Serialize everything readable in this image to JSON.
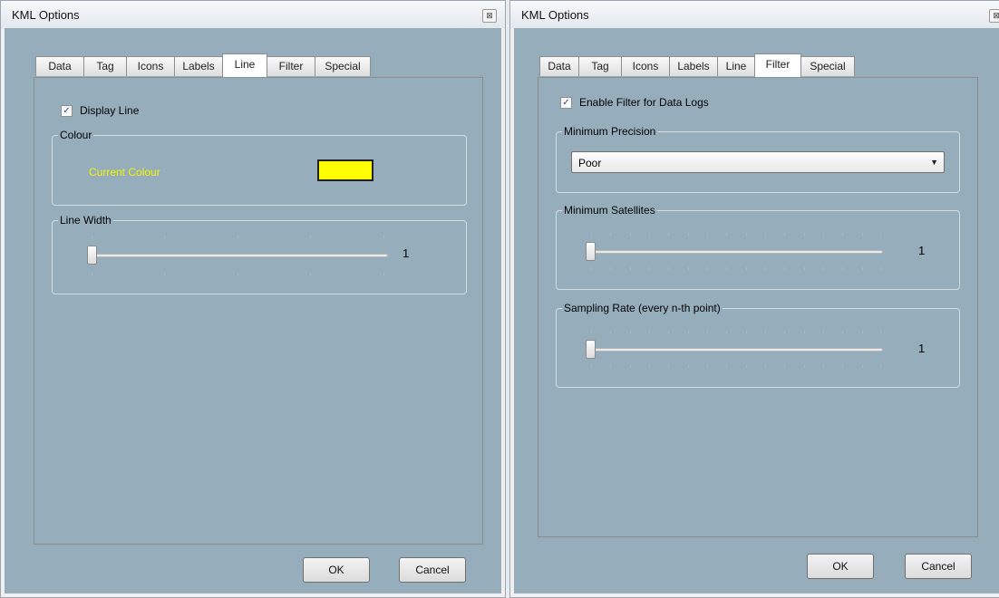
{
  "left_window": {
    "title": "KML Options",
    "close_glyph": "⊠",
    "tabs": [
      {
        "label": "Data"
      },
      {
        "label": "Tag"
      },
      {
        "label": "Icons"
      },
      {
        "label": "Labels"
      },
      {
        "label": "Line",
        "active": true
      },
      {
        "label": "Filter"
      },
      {
        "label": "Special"
      }
    ],
    "display_line": {
      "label": "Display Line",
      "checked": true
    },
    "colour_group": {
      "title": "Colour",
      "label": "Current Colour",
      "label_color": "#f5f500",
      "swatch_color": "#ffff00"
    },
    "line_width_group": {
      "title": "Line Width",
      "value": "1",
      "slider_level": 0
    },
    "ok_label": "OK",
    "cancel_label": "Cancel"
  },
  "right_window": {
    "title": "KML Options",
    "close_glyph": "⊠",
    "tabs": [
      {
        "label": "Data"
      },
      {
        "label": "Tag"
      },
      {
        "label": "Icons"
      },
      {
        "label": "Labels"
      },
      {
        "label": "Line"
      },
      {
        "label": "Filter",
        "active": true
      },
      {
        "label": "Special"
      }
    ],
    "enable_filter": {
      "label": "Enable Filter for Data Logs",
      "checked": true
    },
    "min_precision": {
      "title": "Minimum Precision",
      "selected": "Poor"
    },
    "min_satellites": {
      "title": "Minimum Satellites",
      "value": "1",
      "slider_level": 0
    },
    "sampling_rate": {
      "title": "Sampling Rate (every n-th point)",
      "value": "1",
      "slider_level": 0
    },
    "ok_label": "OK",
    "cancel_label": "Cancel"
  },
  "colors": {
    "client_bg": "#96aebc",
    "check_mark": "✓",
    "dropdown_arrow": "▼"
  }
}
